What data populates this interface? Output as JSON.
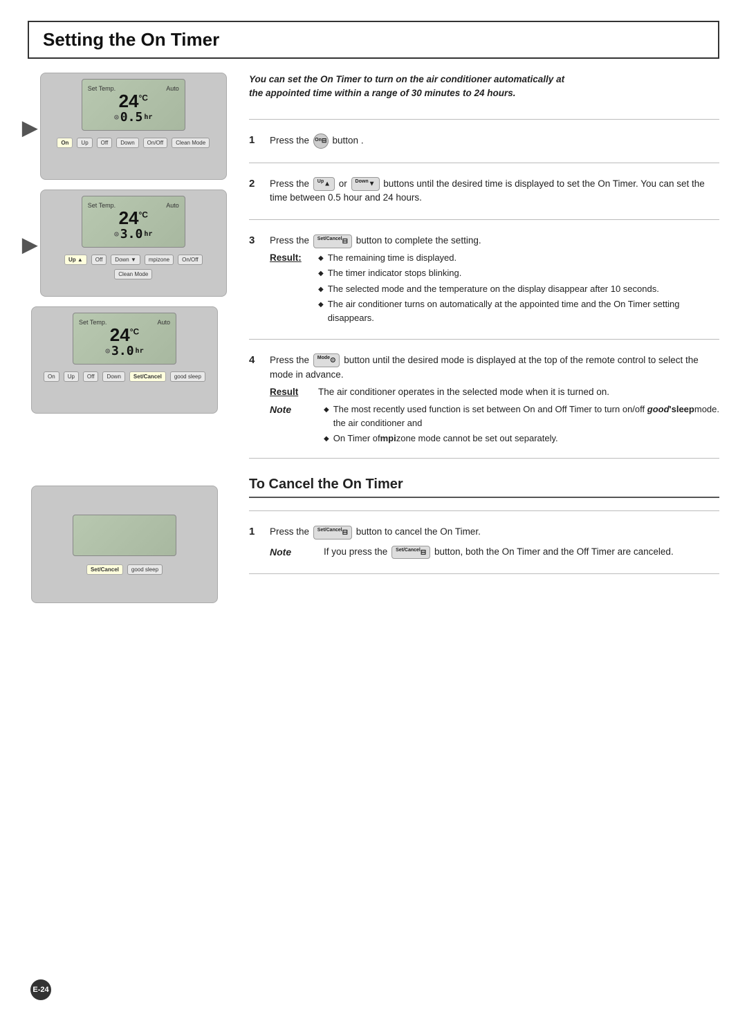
{
  "page": {
    "title": "Setting the On Timer",
    "page_number": "E-24"
  },
  "intro": {
    "text": "You can set the On Timer to turn on the air conditioner automatically at the appointed time within a range of 30 minutes to 24 hours."
  },
  "steps": [
    {
      "num": "1",
      "text": "Press the",
      "btn_label": "On",
      "btn_suffix": "button ."
    },
    {
      "num": "2",
      "text_before": "Press the",
      "btn1_label": "Up",
      "middle_text": "or",
      "btn2_label": "Down",
      "text_after": "buttons until the desired time is displayed to set the On Timer. You can set the time between 0.5 hour and 24 hours."
    },
    {
      "num": "3",
      "text": "Press the",
      "btn_label": "Set/Cancel",
      "text_after": "button to complete the setting.",
      "result_label": "Result:",
      "result_bullets": [
        "The remaining time is displayed.",
        "The timer indicator stops blinking.",
        "The selected mode and the temperature on the display disappear after 10 seconds.",
        "The air conditioner turns on automatically at the appointed time and the On Timer setting disappears."
      ]
    },
    {
      "num": "4",
      "text": "Press the",
      "btn_label": "Mode",
      "text_after": "button until the desired mode is displayed at the top of the remote control to select the mode in advance.",
      "result_label": "Result",
      "result_text": "The air conditioner operates in the selected mode when it is turned on.",
      "note_label": "Note",
      "note_bullets": [
        "The most recently used function is set between On and Off Timer to turn on/off the air conditioner and good'sleep mode.",
        "On Timer of mpizone mode cannot be set out separately."
      ]
    }
  ],
  "cancel_section": {
    "title": "To Cancel the On Timer",
    "steps": [
      {
        "num": "1",
        "text": "Press the",
        "btn_label": "Set/Cancel",
        "text_after": "button to cancel the On Timer.",
        "note_label": "Note",
        "note_text": "If you press the",
        "note_btn": "Set/Cancel",
        "note_text_after": "button, both the On Timer and the Off Timer are canceled."
      }
    ]
  },
  "remotes": [
    {
      "id": "remote1",
      "screen_top_left": "Set Temp.",
      "screen_top_right": "Auto",
      "temp": "24",
      "temp_unit": "C",
      "timer": "0.5",
      "timer_icon": "On",
      "timer_unit": "hr",
      "has_arrow": true,
      "highlighted_btn": "On"
    },
    {
      "id": "remote2",
      "screen_top_left": "Set Temp.",
      "screen_top_right": "Auto",
      "temp": "24",
      "temp_unit": "C",
      "timer": "3.0",
      "timer_icon": "On",
      "timer_unit": "hr",
      "has_arrow": true,
      "highlighted_btn": "Up"
    },
    {
      "id": "remote3",
      "screen_top_left": "Set Temp.",
      "screen_top_right": "Auto",
      "temp": "24",
      "temp_unit": "C",
      "timer": "3.0",
      "timer_icon": "On",
      "timer_unit": "hr",
      "has_arrow": false,
      "highlighted_btn": "Set/Cancel"
    }
  ]
}
